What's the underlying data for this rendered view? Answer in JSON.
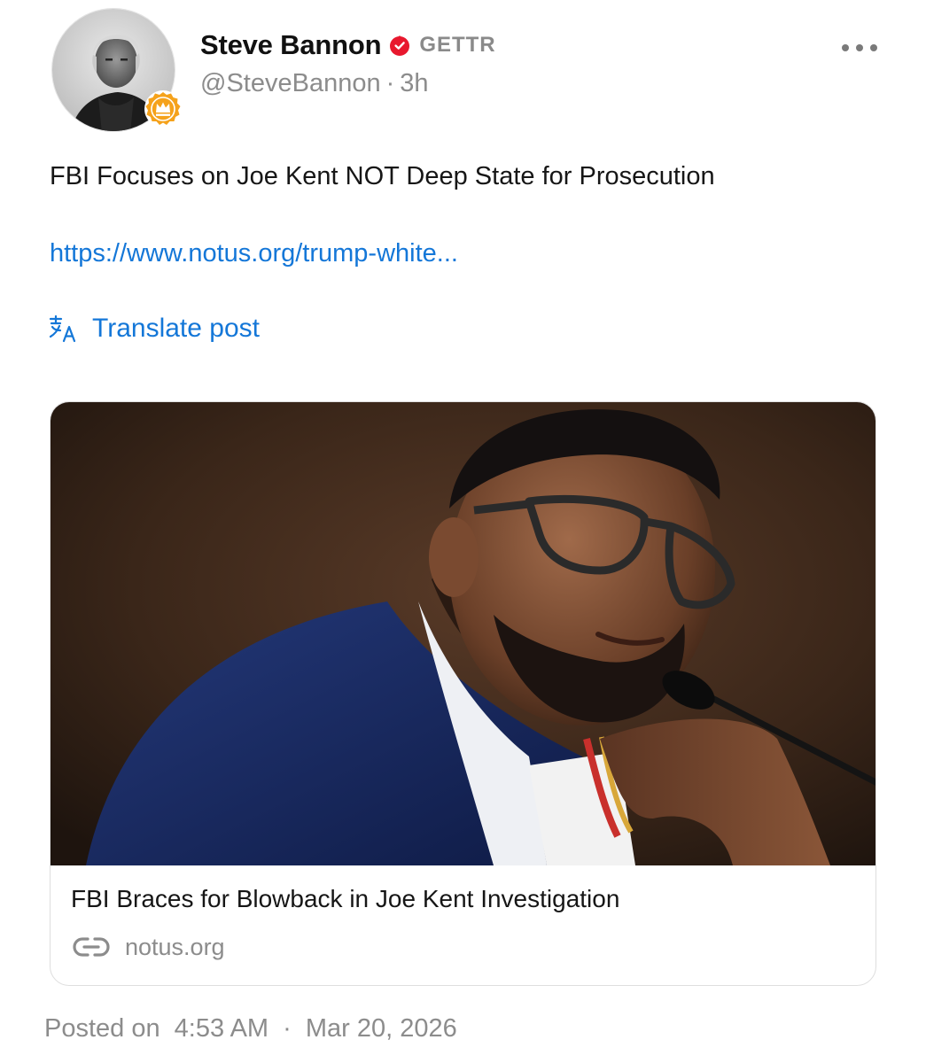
{
  "author": {
    "display_name": "Steve Bannon",
    "platform_badge": "GETTR",
    "handle": "@SteveBannon",
    "separator": "·",
    "age": "3h",
    "avatar_icon": "profile-photo",
    "badge_icon": "crown-icon",
    "verified_icon": "verified-flame-icon"
  },
  "post": {
    "text": "FBI Focuses on Joe Kent NOT Deep State for Prosecution",
    "link_text": "https://www.notus.org/trump-white...",
    "translate_label": "Translate post"
  },
  "link_card": {
    "title": "FBI Braces for Blowback in Joe Kent Investigation",
    "domain": "notus.org"
  },
  "footer": {
    "posted_prefix": "Posted on",
    "time": "4:53 AM",
    "separator": "·",
    "date": "Mar 20, 2026"
  },
  "colors": {
    "link": "#1477d8",
    "muted": "#8c8c8c",
    "verified": "#e8182e",
    "badge_orange": "#f5a21b"
  }
}
